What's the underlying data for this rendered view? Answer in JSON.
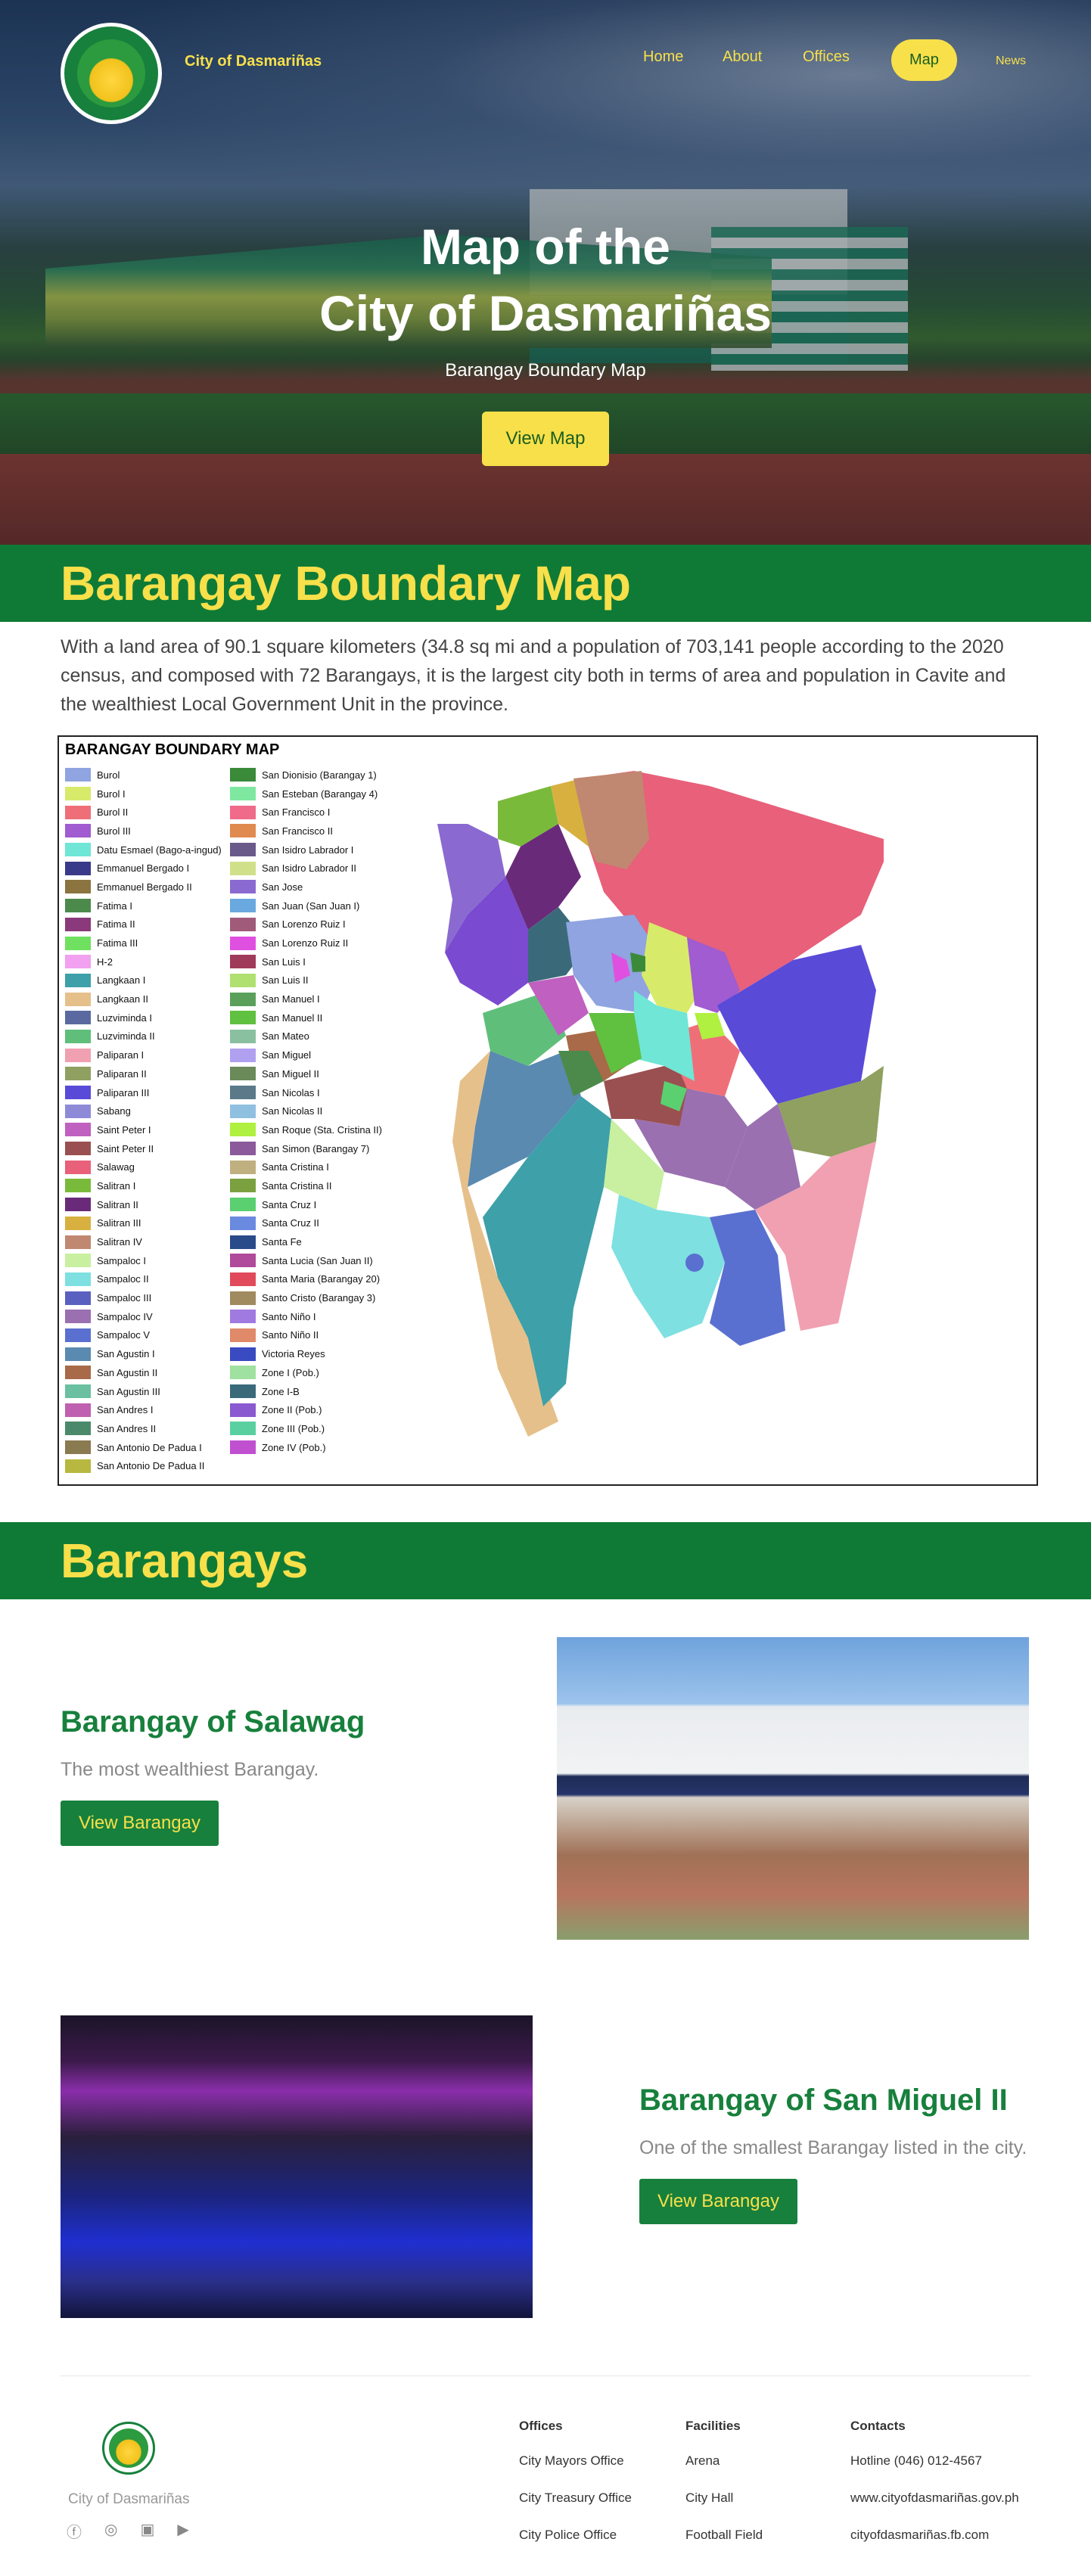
{
  "header": {
    "brand": "City of Dasmariñas",
    "nav": {
      "home": "Home",
      "about": "About",
      "offices": "Offices",
      "map": "Map",
      "news": "News"
    }
  },
  "hero": {
    "title_line1": "Map of the",
    "title_line2": "City of Dasmariñas",
    "subtitle": "Barangay Boundary Map",
    "button": "View Map"
  },
  "boundary": {
    "heading": "Barangay Boundary Map",
    "intro": "With a land area of 90.1 square kilometers (34.8 sq mi and a population of 703,141 people according to the 2020 census, and composed with 72 Barangays, it is the largest city both in terms of area and population in Cavite and the wealthiest Local Government Unit in the province.",
    "map_title": "BARANGAY BOUNDARY MAP",
    "legend_left": [
      [
        "Burol",
        "#8fa4e0"
      ],
      [
        "Burol I",
        "#d8ea6a"
      ],
      [
        "Burol II",
        "#ef6f78"
      ],
      [
        "Burol III",
        "#a05cd0"
      ],
      [
        "Datu Esmael (Bago-a-ingud)",
        "#6fe6d6"
      ],
      [
        "Emmanuel Bergado I",
        "#3a3a8a"
      ],
      [
        "Emmanuel Bergado II",
        "#8b7440"
      ],
      [
        "Fatima I",
        "#4c8a4c"
      ],
      [
        "Fatima II",
        "#8a3a7a"
      ],
      [
        "Fatima III",
        "#6fe060"
      ],
      [
        "H-2",
        "#f2a0f0"
      ],
      [
        "Langkaan I",
        "#3ea0a8"
      ],
      [
        "Langkaan II",
        "#e6c08a"
      ],
      [
        "Luzviminda I",
        "#5a6aa0"
      ],
      [
        "Luzviminda II",
        "#5fbf7a"
      ],
      [
        "Paliparan I",
        "#f0a0b0"
      ],
      [
        "Paliparan II",
        "#8fa060"
      ],
      [
        "Paliparan III",
        "#5a4ad8"
      ],
      [
        "Sabang",
        "#8f8ad8"
      ],
      [
        "Saint Peter I",
        "#c060c0"
      ],
      [
        "Saint Peter II",
        "#9a5050"
      ],
      [
        "Salawag",
        "#e8607a"
      ],
      [
        "Salitran I",
        "#7aba3a"
      ],
      [
        "Salitran II",
        "#6a2a7a"
      ],
      [
        "Salitran III",
        "#d8b040"
      ],
      [
        "Salitran IV",
        "#c08870"
      ],
      [
        "Sampaloc I",
        "#c8f0a0"
      ],
      [
        "Sampaloc II",
        "#7ee0e0"
      ],
      [
        "Sampaloc III",
        "#5a60c0"
      ],
      [
        "Sampaloc IV",
        "#9a70b0"
      ],
      [
        "Sampaloc V",
        "#5a70d0"
      ],
      [
        "San Agustin I",
        "#5a8ab0"
      ],
      [
        "San Agustin II",
        "#a86a48"
      ],
      [
        "San Agustin III",
        "#6ac0a0"
      ],
      [
        "San Andres I",
        "#c060b0"
      ],
      [
        "San Andres II",
        "#4a8a6a"
      ],
      [
        "San Antonio De Padua I",
        "#8a7a50"
      ],
      [
        "San Antonio De Padua II",
        "#b8b840"
      ]
    ],
    "legend_right": [
      [
        "San Dionisio (Barangay 1)",
        "#3a8a3a"
      ],
      [
        "San Esteban (Barangay 4)",
        "#7ee8a0"
      ],
      [
        "San Francisco I",
        "#f06a8a"
      ],
      [
        "San Francisco II",
        "#e08a50"
      ],
      [
        "San Isidro Labrador I",
        "#6a5a8a"
      ],
      [
        "San Isidro Labrador II",
        "#d0e08a"
      ],
      [
        "San Jose",
        "#8a6ad0"
      ],
      [
        "San Juan (San Juan I)",
        "#6aa8e0"
      ],
      [
        "San Lorenzo Ruiz I",
        "#a05a7a"
      ],
      [
        "San Lorenzo Ruiz II",
        "#e050e0"
      ],
      [
        "San Luis I",
        "#a03a5a"
      ],
      [
        "San Luis II",
        "#b0e070"
      ],
      [
        "San Manuel I",
        "#5aa05a"
      ],
      [
        "San Manuel II",
        "#60c040"
      ],
      [
        "San Mateo",
        "#8ac0a0"
      ],
      [
        "San Miguel",
        "#b0a0f0"
      ],
      [
        "San Miguel II",
        "#6a8a5a"
      ],
      [
        "San Nicolas I",
        "#5a7a8a"
      ],
      [
        "San Nicolas II",
        "#90c0e0"
      ],
      [
        "San Roque (Sta. Cristina II)",
        "#b0f040"
      ],
      [
        "San Simon (Barangay 7)",
        "#8a5a9a"
      ],
      [
        "Santa Cristina I",
        "#c0b080"
      ],
      [
        "Santa Cristina II",
        "#7aa040"
      ],
      [
        "Santa Cruz I",
        "#5ad070"
      ],
      [
        "Santa Cruz II",
        "#6a8ae0"
      ],
      [
        "Santa Fe",
        "#2a4a8a"
      ],
      [
        "Santa Lucia (San Juan II)",
        "#b04a9a"
      ],
      [
        "Santa Maria (Barangay 20)",
        "#e04a5a"
      ],
      [
        "Santo Cristo (Barangay 3)",
        "#a08a60"
      ],
      [
        "Santo Niño I",
        "#a07ae0"
      ],
      [
        "Santo Niño II",
        "#e08a6a"
      ],
      [
        "Victoria Reyes",
        "#3a4ac0"
      ],
      [
        "Zone I (Pob.)",
        "#a0e0a0"
      ],
      [
        "Zone I-B",
        "#3a6a7a"
      ],
      [
        "Zone II (Pob.)",
        "#8a5ad0"
      ],
      [
        "Zone III (Pob.)",
        "#5ad0a0"
      ],
      [
        "Zone IV (Pob.)",
        "#c050d0"
      ]
    ]
  },
  "barangays": {
    "heading": "Barangays",
    "cards": [
      {
        "title": "Barangay of Salawag",
        "desc": "The most wealthiest Barangay.",
        "button": "View Barangay"
      },
      {
        "title": "Barangay of San Miguel II",
        "desc": "One of the smallest Barangay listed in the city.",
        "button": "View Barangay"
      }
    ]
  },
  "footer": {
    "brand": "City of Dasmariñas",
    "offices": {
      "heading": "Offices",
      "links": [
        "City Mayors Office",
        "City Treasury Office",
        "City Police Office"
      ]
    },
    "facilities": {
      "heading": "Facilities",
      "links": [
        "Arena",
        "City Hall",
        "Football Field"
      ]
    },
    "contacts": {
      "heading": "Contacts",
      "links": [
        "Hotline (046) 012-4567",
        "www.cityofdasmariñas.gov.ph",
        "cityofdasmariñas.fb.com"
      ]
    }
  }
}
